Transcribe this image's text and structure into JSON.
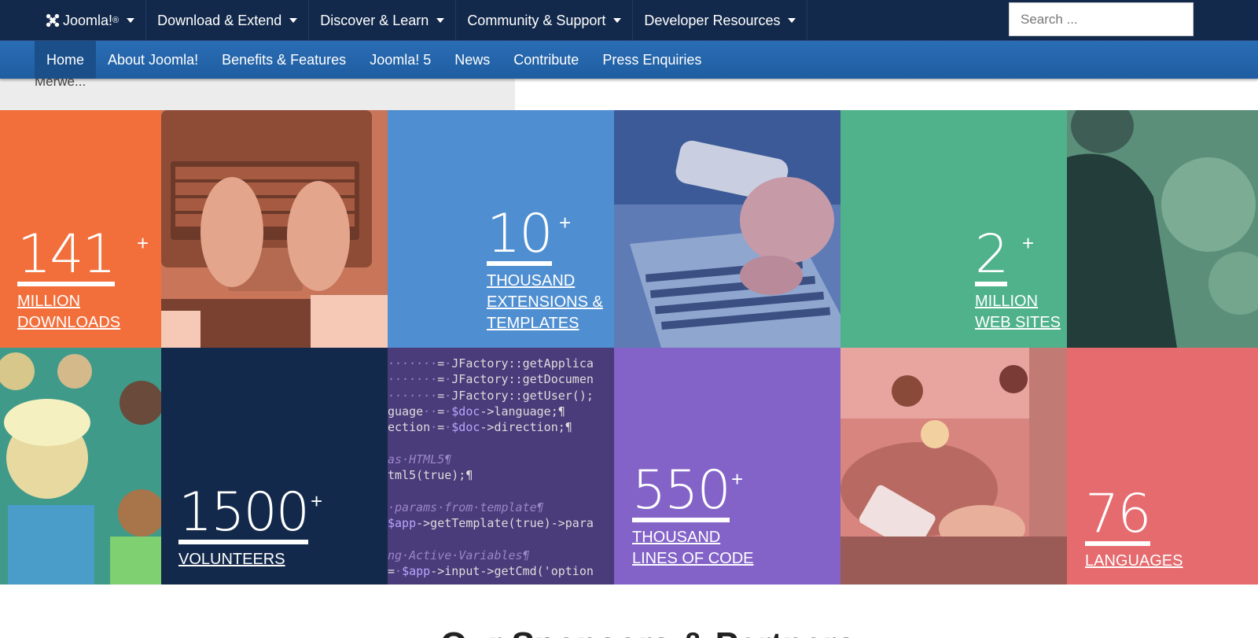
{
  "topnav": {
    "items": [
      {
        "label": "Joomla!",
        "sup": "®"
      },
      {
        "label": "Download & Extend"
      },
      {
        "label": "Discover & Learn"
      },
      {
        "label": "Community & Support"
      },
      {
        "label": "Developer Resources"
      }
    ],
    "search_placeholder": "Search ..."
  },
  "subnav": {
    "items": [
      "Home",
      "About Joomla!",
      "Benefits & Features",
      "Joomla! 5",
      "News",
      "Contribute",
      "Press Enquiries"
    ],
    "active": "Home"
  },
  "behind_text": "Merwe...",
  "stats": [
    {
      "number": "141",
      "plus": "+",
      "label_lines": [
        "MILLION",
        "DOWNLOADS"
      ],
      "color": "#f26f3c"
    },
    {
      "number": "10",
      "plus": "+",
      "label_lines": [
        "THOUSAND",
        "EXTENSIONS &",
        "TEMPLATES"
      ],
      "color": "#4f8fd1"
    },
    {
      "number": "2",
      "plus": "+",
      "label_lines": [
        "MILLION",
        "WEB SITES"
      ],
      "color": "#4fb28b"
    },
    {
      "number": "1500",
      "plus": "+",
      "label_lines": [
        "VOLUNTEERS"
      ],
      "color": "#13294b"
    },
    {
      "number": "550",
      "plus": "+",
      "label_lines": [
        "THOUSAND",
        "LINES OF CODE"
      ],
      "color": "#8363c8"
    },
    {
      "number": "76",
      "plus": "",
      "label_lines": [
        "LANGUAGES"
      ],
      "color": "#e56b6f"
    }
  ],
  "code_lines": [
    "·······=·JFactory::getApplica",
    "·······=·JFactory::getDocumen",
    "·······=·JFactory::getUser();",
    "guage··=·$doc->language;¶",
    "ection·=·$doc->direction;¶",
    "",
    "as·HTML5¶",
    "tml5(true);¶",
    "",
    "·params·from·template¶",
    "$app->getTemplate(true)->para",
    "",
    "ng·Active·Variables¶",
    "=·$app->input->getCmd('option"
  ],
  "bottom_title": "Our Sponsors & Partners",
  "colors": {
    "topbar": "#13294b",
    "subbar": "#2a6db5",
    "orange": "#f26f3c",
    "blue": "#4f8fd1",
    "green": "#4fb28b",
    "navy": "#13294b",
    "purple": "#8363c8",
    "pink": "#e56b6f"
  }
}
